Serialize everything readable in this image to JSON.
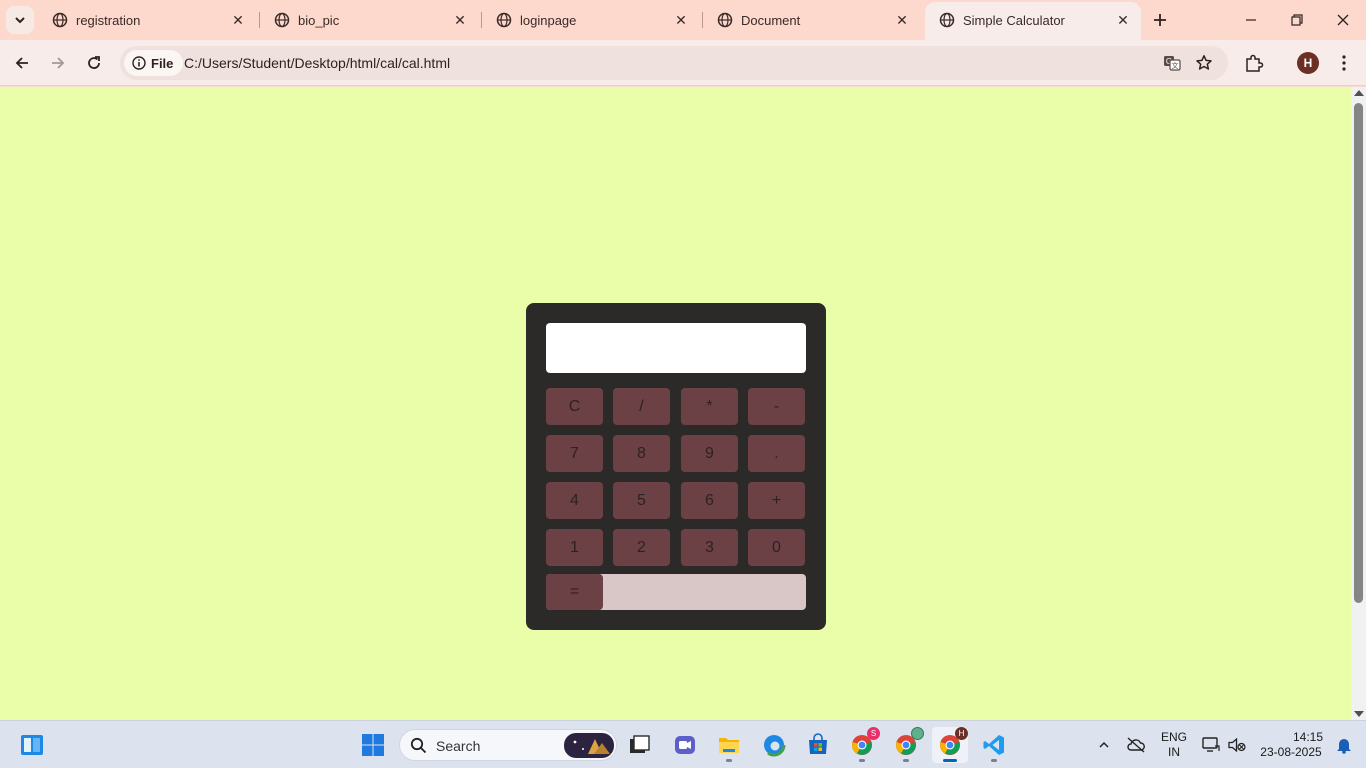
{
  "browser": {
    "tabs": [
      {
        "title": "registration"
      },
      {
        "title": "bio_pic"
      },
      {
        "title": "loginpage"
      },
      {
        "title": "Document"
      },
      {
        "title": "Simple Calculator",
        "active": true
      }
    ],
    "site_chip": "File",
    "url": "C:/Users/Student/Desktop/html/cal/cal.html",
    "profile_initial": "H"
  },
  "calculator": {
    "display_value": "",
    "keys": [
      [
        "C",
        "/",
        "*",
        "-"
      ],
      [
        "7",
        "8",
        "9",
        "."
      ],
      [
        "4",
        "5",
        "6",
        "+"
      ],
      [
        "1",
        "2",
        "3",
        "0"
      ]
    ],
    "equals_label": "="
  },
  "taskbar": {
    "search_label": "Search",
    "language_line1": "ENG",
    "language_line2": "IN",
    "time": "14:15",
    "date": "23-08-2025",
    "chrome_badge_1": "S",
    "chrome_badge_3": "H"
  },
  "colors": {
    "page_background": "#eafda9",
    "calculator_body": "#2c2a28",
    "key_background": "#6b4145",
    "equals_track": "#d9c7c8",
    "browser_frame": "#fcd8cd"
  }
}
